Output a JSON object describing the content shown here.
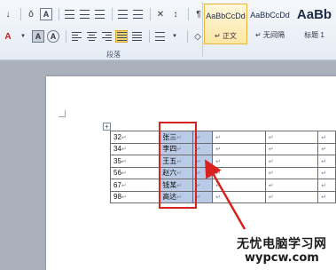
{
  "ribbon": {
    "paragraph_group_label": "段落",
    "styles": [
      {
        "sample": "AaBbCcDd",
        "name": "↵ 正文",
        "current": true
      },
      {
        "sample": "AaBbCcDd",
        "name": "↵ 无间隔",
        "current": false
      },
      {
        "sample": "AaBb",
        "name": "标题 1",
        "current": false
      }
    ],
    "row1": {
      "font_size_grow": "↓",
      "phonetic": "ǒ",
      "border_char": "A",
      "sort": "↕",
      "show_marks": "¶"
    },
    "row2": {
      "font_color_glyph": "A",
      "highlight_glyph": "A",
      "char_border": "A",
      "accent_red": "#c41e1e"
    }
  },
  "table": {
    "rows": [
      {
        "num": "32",
        "name": "张三"
      },
      {
        "num": "34",
        "name": "李四"
      },
      {
        "num": "35",
        "name": "王五"
      },
      {
        "num": "56",
        "name": "赵六"
      },
      {
        "num": "67",
        "name": "钱某"
      },
      {
        "num": "98",
        "name": "高达"
      }
    ],
    "mark": "↵",
    "move_handle": "+"
  },
  "watermark": {
    "line1": "无忧电脑学习网",
    "line2": "wypcw.com"
  },
  "colors": {
    "highlight_red": "#d8221e",
    "selection_blue": "#b9cbe6"
  }
}
